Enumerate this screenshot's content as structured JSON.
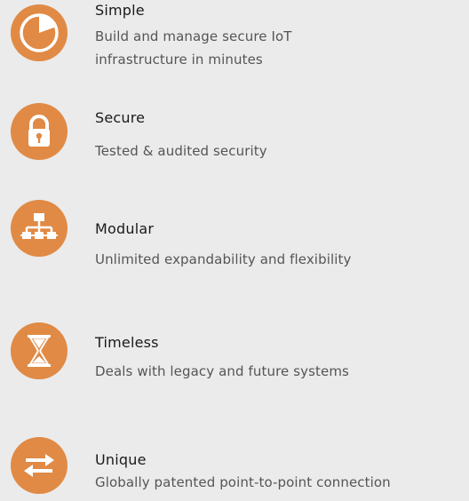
{
  "accent_color": "#e08a45",
  "features": [
    {
      "icon": "clock-pie-icon",
      "title": "Simple",
      "description": "Build and manage secure IoT infrastructure in minutes"
    },
    {
      "icon": "padlock-icon",
      "title": "Secure",
      "description": "Tested & audited security"
    },
    {
      "icon": "hierarchy-network-icon",
      "title": "Modular",
      "description": "Unlimited expandability and flexibility"
    },
    {
      "icon": "hourglass-icon",
      "title": "Timeless",
      "description": "Deals with legacy and future systems"
    },
    {
      "icon": "exchange-arrows-icon",
      "title": "Unique",
      "description": "Globally patented point-to-point connection"
    }
  ]
}
